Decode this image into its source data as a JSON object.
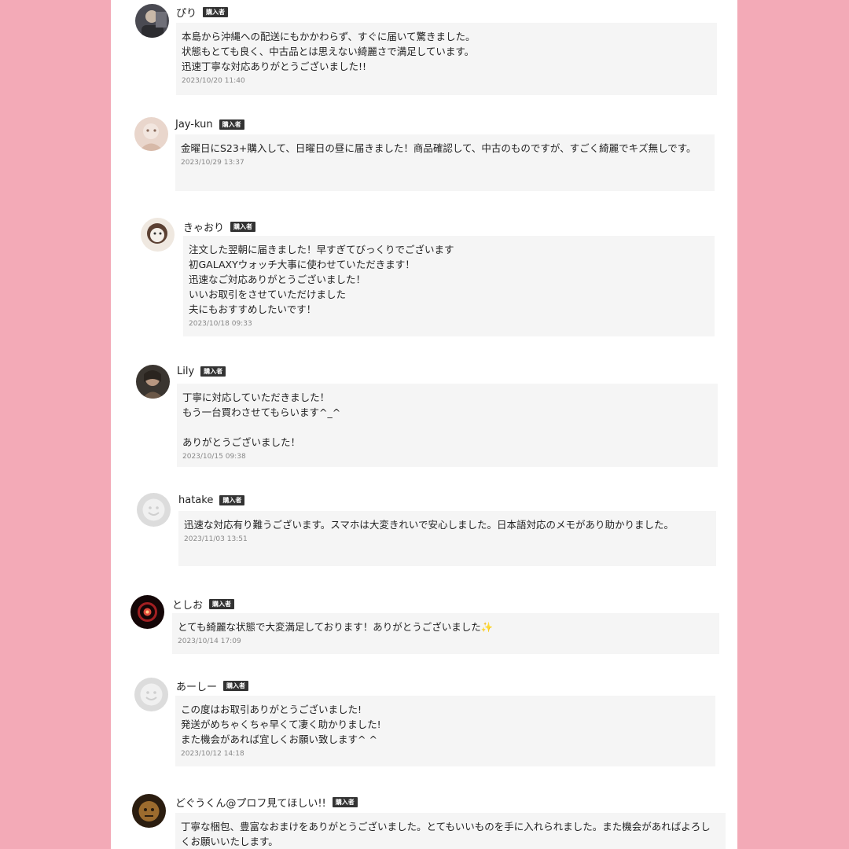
{
  "page": {
    "background_color": "#f3aab7",
    "panel_color": "#ffffff",
    "bubble_color": "#f5f5f5",
    "badge_color": "#333333"
  },
  "reviews": [
    {
      "name": "ぴり",
      "badge": "購入者",
      "avatar_icon": "user-photo-icon",
      "message": "本島から沖縄への配送にもかかわらず、すぐに届いて驚きました。\n状態もとても良く、中古品とは思えない綺麗さで満足しています。\n迅速丁寧な対応ありがとうございました!!",
      "date": "2023/10/20 11:40"
    },
    {
      "name": "Jay-kun",
      "badge": "購入者",
      "avatar_icon": "user-photo-icon",
      "message": "金曜日にS23+購入して、日曜日の昼に届きました！商品確認して、中古のものですが、すごく綺麗でキズ無しです。",
      "date": "2023/10/29 13:37"
    },
    {
      "name": "きゃおり",
      "badge": "購入者",
      "avatar_icon": "user-photo-icon",
      "message": "注文した翌朝に届きました！早すぎてびっくりでございます\n初GALAXYウォッチ大事に使わせていただきます！\n迅速なご対応ありがとうございました！\nいいお取引をさせていただけました\n夫にもおすすめしたいです！",
      "date": "2023/10/18 09:33"
    },
    {
      "name": "Lily",
      "badge": "購入者",
      "avatar_icon": "user-photo-icon",
      "message": "丁寧に対応していただきました！\nもう一台買わさせてもらいます^_^\n\nありがとうございました！",
      "date": "2023/10/15 09:38"
    },
    {
      "name": "hatake",
      "badge": "購入者",
      "avatar_icon": "default-user-icon",
      "message": "迅速な対応有り難うございます。スマホは大変きれいで安心しました。日本語対応のメモがあり助かりました。",
      "date": "2023/11/03 13:51"
    },
    {
      "name": "としお",
      "badge": "購入者",
      "avatar_icon": "user-photo-icon",
      "message": "とても綺麗な状態で大変満足しております！ありがとうございました✨",
      "date": "2023/10/14 17:09"
    },
    {
      "name": "あーしー",
      "badge": "購入者",
      "avatar_icon": "default-user-icon",
      "message": "この度はお取引ありがとうございました!\n発送がめちゃくちゃ早くて凄く助かりました!\nまた機会があれば宜しくお願い致します^ ^",
      "date": "2023/10/12 14:18"
    },
    {
      "name": "どぐうくん@プロフ見てほしい!!",
      "badge": "購入者",
      "avatar_icon": "user-photo-icon",
      "message": "丁寧な梱包、豊富なおまけをありがとうございました。とてもいいものを手に入れられました。また機会があればよろしくお願いいたします。",
      "date": ""
    }
  ]
}
